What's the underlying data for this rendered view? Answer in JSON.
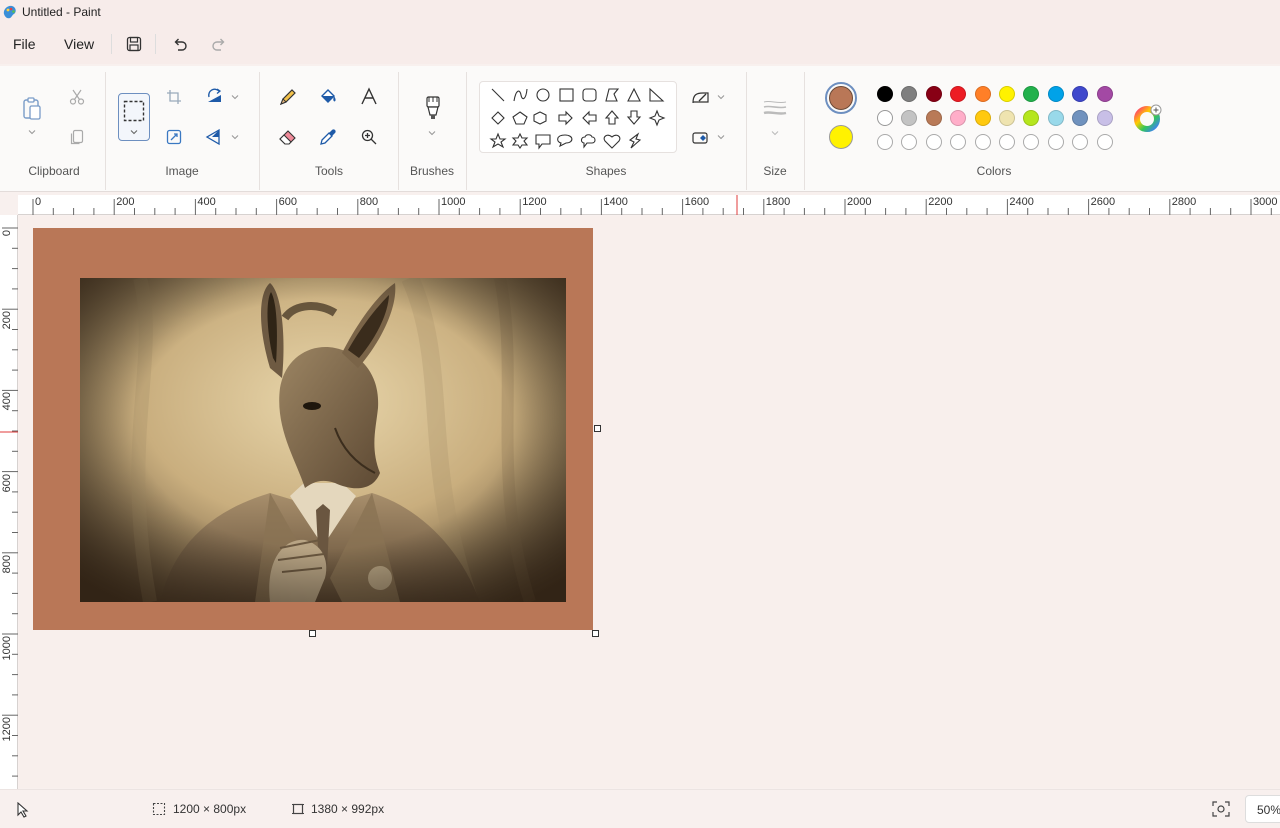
{
  "window": {
    "title": "Untitled - Paint",
    "icon": "paint-app-icon"
  },
  "menu": {
    "file": "File",
    "view": "View"
  },
  "quick_access": {
    "icons": [
      "save-icon",
      "undo-icon",
      "redo-icon"
    ]
  },
  "ribbon": {
    "groups": {
      "clipboard": "Clipboard",
      "image": "Image",
      "tools": "Tools",
      "brushes": "Brushes",
      "shapes": "Shapes",
      "size": "Size",
      "colors": "Colors"
    }
  },
  "colors": {
    "primary": "#b97757",
    "secondary": "#fff200",
    "row1": [
      "#000000",
      "#7f7f7f",
      "#880015",
      "#ed1c24",
      "#ff7f27",
      "#fff200",
      "#22b14c",
      "#00a2e8",
      "#3f48cc",
      "#a349a4"
    ],
    "row2": [
      "#ffffff",
      "#c3c3c3",
      "#b97a57",
      "#ffaec9",
      "#ffc90e",
      "#efe4b0",
      "#b5e61d",
      "#99d9ea",
      "#7092be",
      "#c8bfe7"
    ]
  },
  "ruler": {
    "h_labels": [
      "0",
      "200",
      "400",
      "600",
      "800",
      "1000",
      "1200",
      "1400",
      "1600",
      "1800",
      "2000",
      "2200",
      "2400",
      "2600",
      "2800",
      "3000"
    ],
    "v_labels": [
      "0",
      "200",
      "400",
      "600",
      "800",
      "1000",
      "1200"
    ]
  },
  "status": {
    "selection_size": "1200 × 800px",
    "canvas_size": "1380 × 992px",
    "zoom": "50%"
  }
}
